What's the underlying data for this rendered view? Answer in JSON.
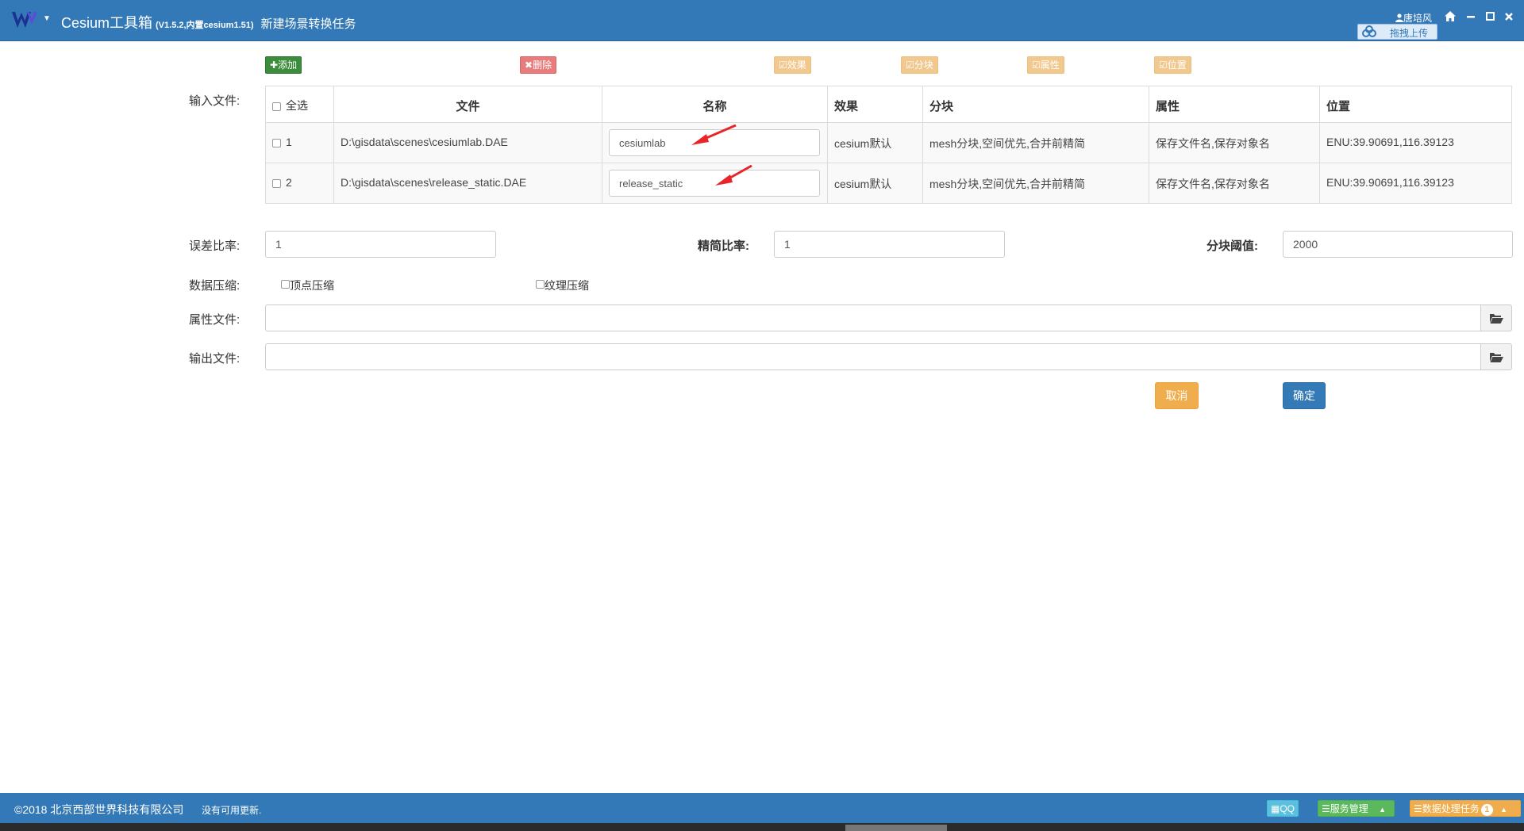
{
  "header": {
    "app_title": "Cesium工具箱",
    "version": "(V1.5.2,内置cesium1.51)",
    "page_subtitle": "新建场景转换任务",
    "user_name": "唐培风",
    "upload_label": "拖拽上传",
    "icons": [
      "logo-w-icon",
      "chevron-down-icon",
      "user-icon",
      "home-icon",
      "minimize-icon",
      "maximize-icon",
      "close-icon",
      "baidu-cloud-icon"
    ]
  },
  "toolbar": {
    "add_label": "添加",
    "delete_label": "删除",
    "effect_label": "效果",
    "tile_label": "分块",
    "attribute_label": "属性",
    "position_label": "位置"
  },
  "form": {
    "input_files_label": "输入文件:",
    "error_ratio_label": "误差比率:",
    "error_ratio_value": "1",
    "simplify_ratio_label": "精简比率:",
    "simplify_ratio_value": "1",
    "tile_threshold_label": "分块阈值:",
    "tile_threshold_value": "2000",
    "compression_label": "数据压缩:",
    "vertex_compression_label": "顶点压缩",
    "texture_compression_label": "纹理压缩",
    "attribute_file_label": "属性文件:",
    "attribute_file_value": "",
    "output_file_label": "输出文件:",
    "output_file_value": "",
    "cancel_label": "取消",
    "ok_label": "确定"
  },
  "table": {
    "columns": [
      "全选",
      "文件",
      "名称",
      "效果",
      "分块",
      "属性",
      "位置"
    ],
    "rows": [
      {
        "index": "1",
        "file": "D:\\gisdata\\scenes\\cesiumlab.DAE",
        "name": "cesiumlab",
        "effect": "cesium默认",
        "tile": "mesh分块,空间优先,合并前精简",
        "attribute": "保存文件名,保存对象名",
        "position": "ENU:39.90691,116.39123"
      },
      {
        "index": "2",
        "file": "D:\\gisdata\\scenes\\release_static.DAE",
        "name": "release_static",
        "effect": "cesium默认",
        "tile": "mesh分块,空间优先,合并前精简",
        "attribute": "保存文件名,保存对象名",
        "position": "ENU:39.90691,116.39123"
      }
    ]
  },
  "footer": {
    "copyright": "©2018 北京西部世界科技有限公司",
    "update_status": "没有可用更新.",
    "qq_label": "QQ",
    "service_label": "服务管理",
    "tasks_label": "数据处理任务",
    "tasks_count": "1"
  },
  "colors": {
    "brand_blue": "#3479b7",
    "add_green": "#3b8d3b",
    "delete_red": "#e87b7b",
    "cancel_orange": "#f0ad4e",
    "ok_blue": "#337ab7",
    "annotation_arrow": "#e8262a"
  }
}
